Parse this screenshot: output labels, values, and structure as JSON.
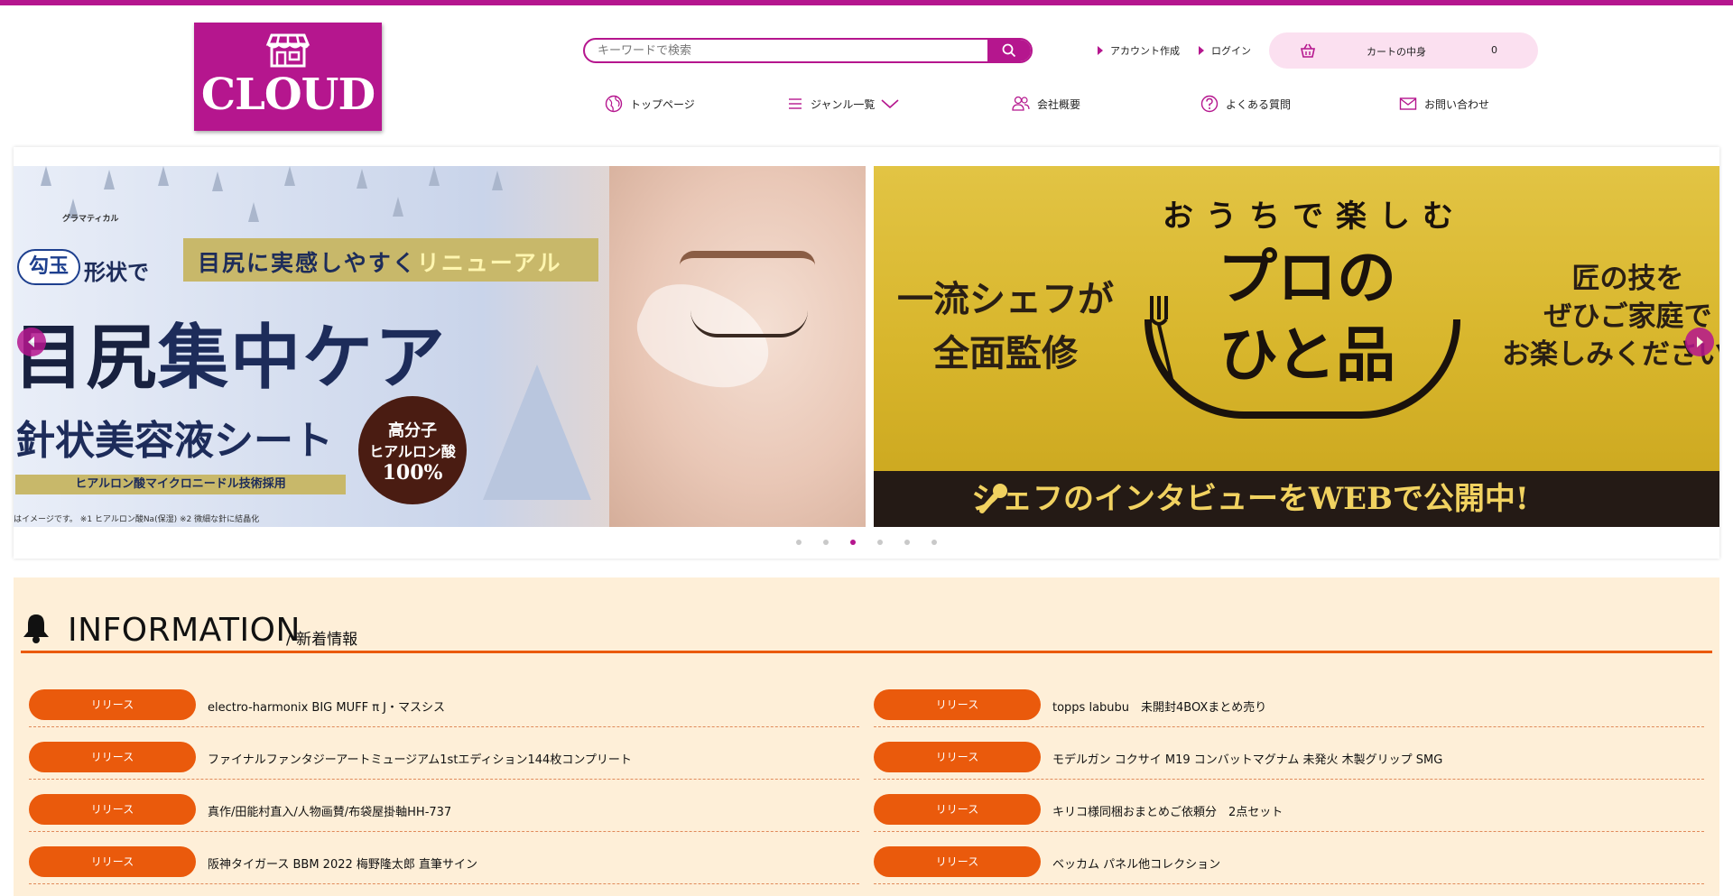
{
  "brand": {
    "logo_text": "CLOUD",
    "accent_color": "#b5168e",
    "secondary_color": "#ea5a0c"
  },
  "search": {
    "placeholder": "キーワードで検索"
  },
  "header_links": {
    "create_account": "アカウント作成",
    "login": "ログイン"
  },
  "cart": {
    "label": "カートの中身",
    "count": "0"
  },
  "nav": {
    "items": [
      {
        "label": "トップページ",
        "icon": "globe-icon"
      },
      {
        "label": "ジャンル一覧",
        "icon": "menu-icon"
      },
      {
        "label": "会社概要",
        "icon": "users-icon"
      },
      {
        "label": "よくある質問",
        "icon": "question-icon"
      },
      {
        "label": "お問い合わせ",
        "icon": "mail-icon"
      }
    ]
  },
  "slider": {
    "active_index": 2,
    "dot_count": 6,
    "slide1": {
      "brand": "グラマティカル",
      "tag_main": "目尻に実感しやすく",
      "tag_accent": "リニューアル",
      "magatama": "勾玉",
      "shape": "形状で",
      "headline_a": "目尻",
      "headline_b": "集中ケア",
      "subheadline": "針状美容液シート",
      "badge_line1": "高分子",
      "badge_line2": "ヒアルロン酸",
      "badge_line3": "100%",
      "strip": "ヒアルロン酸マイクロニードル技術採用",
      "note": "はイメージです。 ※1 ヒアルロン酸Na(保湿) ※2 微細な針に結晶化"
    },
    "slide2": {
      "left_line1": "一流シェフが",
      "left_line2": "全面監修",
      "arc": "おうちで楽しむ",
      "center_line1": "プロの",
      "center_line2": "ひと品",
      "right_line1": "匠の技を",
      "right_line2": "ぜひご家庭で",
      "right_line3": "お楽しみください。",
      "band": "シェフのインタビューをWEBで公開中!"
    }
  },
  "information": {
    "title": "INFORMATION",
    "subtitle": "/ 新着情報",
    "badge_label": "リリース",
    "left": [
      "electro-harmonix BIG MUFF π J・マスシス",
      "ファイナルファンタジーアートミュージアム1stエディション144枚コンプリート",
      "真作/田能村直入/人物画賛/布袋屋掛軸HH-737",
      "阪神タイガース BBM 2022 梅野隆太郎 直筆サイン"
    ],
    "right": [
      "topps labubu　未開封4BOXまとめ売り",
      "モデルガン コクサイ M19 コンバットマグナム 未発火 木製グリップ SMG",
      "キリコ様同梱おまとめご依頼分　2点セット",
      "ベッカム パネル他コレクション"
    ]
  }
}
